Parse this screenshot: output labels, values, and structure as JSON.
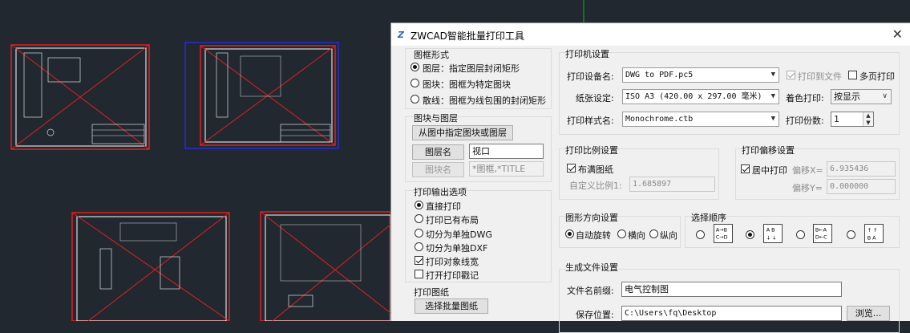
{
  "dialog": {
    "title": "ZWCAD智能批量打印工具",
    "icon": "zwcad-app-icon"
  },
  "frame_style": {
    "label": "图框形式",
    "options": [
      {
        "label": "图层：指定图层封闭矩形",
        "selected": true
      },
      {
        "label": "图块：图框为特定图块",
        "selected": false
      },
      {
        "label": "散线：图框为线包围的封闭矩形",
        "selected": false
      }
    ]
  },
  "block_layer": {
    "label": "图块与图层",
    "pick_button": "从图中指定图块或图层",
    "layer_button": "图层名",
    "layer_value": "视口",
    "block_button": "图块名",
    "block_value": "*图框,*TITLE"
  },
  "output_options": {
    "label": "打印输出选项",
    "radios": [
      {
        "label": "直接打印",
        "selected": true
      },
      {
        "label": "打印已有布局",
        "selected": false
      },
      {
        "label": "切分为单独DWG",
        "selected": false
      },
      {
        "label": "切分为单独DXF",
        "selected": false
      }
    ],
    "checkboxes": [
      {
        "label": "打印对象线宽",
        "checked": true
      },
      {
        "label": "打开打印戳记",
        "checked": false
      }
    ]
  },
  "print_sheets": {
    "label": "打印图纸",
    "select_button": "选择批量图纸"
  },
  "printer": {
    "label": "打印机设置",
    "device_label": "打印设备名:",
    "device_value": "DWG to PDF.pc5",
    "print_to_file": "打印到文件",
    "multipage": "多页打印",
    "paper_label": "纸张设定:",
    "paper_value": "ISO A3 (420.00 x 297.00 毫米)",
    "color_label": "着色打印:",
    "color_value": "按显示",
    "style_label": "打印样式名:",
    "style_value": "Monochrome.ctb",
    "copies_label": "打印份数:",
    "copies_value": "1"
  },
  "scale": {
    "label": "打印比例设置",
    "fill_label": "布满图纸",
    "custom_label": "自定义比例1:",
    "custom_value": "1.685897"
  },
  "offset": {
    "label": "打印偏移设置",
    "center_label": "居中打印",
    "x_label": "偏移X=",
    "x_value": "6.935436",
    "y_label": "偏移Y=",
    "y_value": "0.000000"
  },
  "orientation": {
    "label": "图形方向设置",
    "options": [
      {
        "label": "自动旋转",
        "selected": true
      },
      {
        "label": "横向",
        "selected": false
      },
      {
        "label": "纵向",
        "selected": false
      }
    ]
  },
  "order": {
    "label": "选择顺序",
    "icons": [
      {
        "icon": "order-row-left-to-right-icon",
        "glyph": "A→B C→D",
        "selected": false
      },
      {
        "icon": "order-column-top-to-bottom-icon",
        "glyph": "A↓B ↓ ↓",
        "selected": true
      },
      {
        "icon": "order-row-right-to-left-icon",
        "glyph": "B←A D←C",
        "selected": false
      },
      {
        "icon": "order-column-bottom-to-top-icon",
        "glyph": "B↑A ↑ ↑",
        "selected": false
      }
    ]
  },
  "generate": {
    "label": "生成文件设置",
    "prefix_label": "文件名前缀:",
    "prefix_value": "电气控制图",
    "path_label": "保存位置:",
    "path_value": "C:\\Users\\fq\\Desktop",
    "browse_button": "浏览..."
  },
  "colors": {
    "cad_background": "#212830",
    "frame_red": "#e02020",
    "frame_blue": "#2a2ad8",
    "crosshair_green": "#00c000"
  }
}
